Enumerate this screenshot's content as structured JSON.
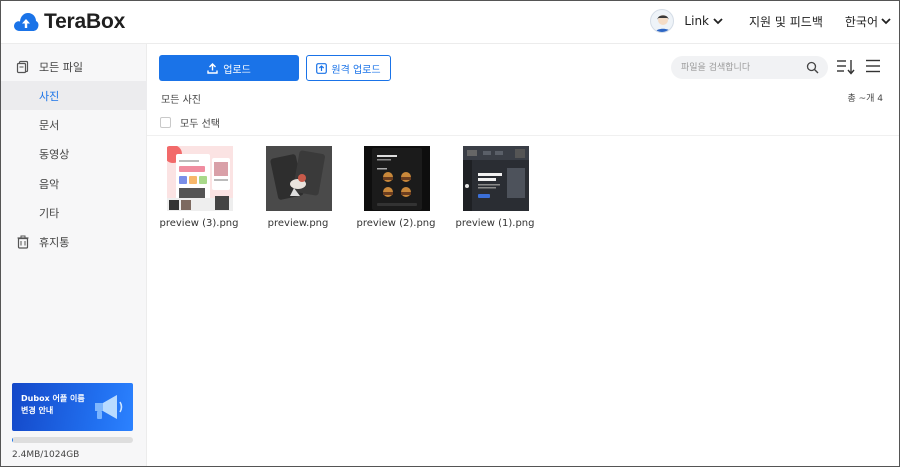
{
  "app": {
    "logo_text": "TeraBox"
  },
  "header": {
    "user_name": "Link",
    "support_label": "지원 및 피드백",
    "language_label": "한국어"
  },
  "sidebar": {
    "items": [
      {
        "label": "모든 파일",
        "icon": "files-icon"
      },
      {
        "label": "사진",
        "active": true
      },
      {
        "label": "문서"
      },
      {
        "label": "동영상"
      },
      {
        "label": "음악"
      },
      {
        "label": "기타"
      },
      {
        "label": "휴지통",
        "icon": "trash-icon"
      }
    ],
    "promo_text": "Dubox 어플 이름 변경 안내",
    "storage_text": "2.4MB/1024GB",
    "storage_used_fraction": 2.3e-06
  },
  "toolbar": {
    "upload_label": "업로드",
    "remote_upload_label": "원격 업로드",
    "search_placeholder": "파일을 검색합니다"
  },
  "main": {
    "breadcrumb": "모든 사진",
    "count_text": "총 ~개 4",
    "select_all_label": "모두 선택",
    "files": [
      {
        "name": "preview (3).png"
      },
      {
        "name": "preview.png"
      },
      {
        "name": "preview (2).png"
      },
      {
        "name": "preview (1).png"
      }
    ]
  },
  "colors": {
    "accent": "#1a73e8",
    "sidebar_bg": "#f7f7f8",
    "promo_bg": "#1f5fe0"
  }
}
